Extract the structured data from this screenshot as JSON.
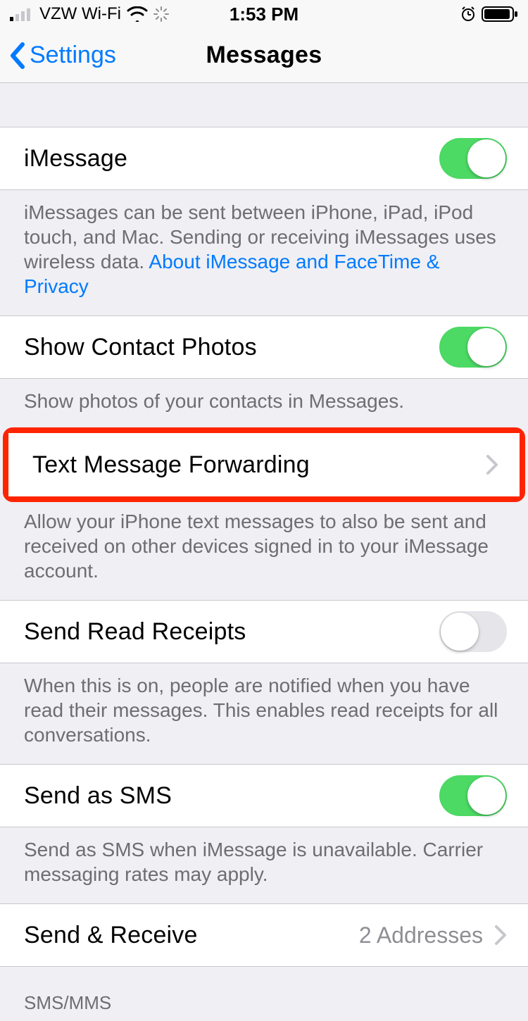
{
  "status": {
    "carrier": "VZW Wi-Fi",
    "time": "1:53 PM"
  },
  "nav": {
    "back": "Settings",
    "title": "Messages"
  },
  "rows": {
    "imessage": {
      "label": "iMessage",
      "on": true
    },
    "imessage_footer": "iMessages can be sent between iPhone, iPad, iPod touch, and Mac. Sending or receiving iMessages uses wireless data. ",
    "imessage_link": "About iMessage and FaceTime & Privacy",
    "contact_photos": {
      "label": "Show Contact Photos",
      "on": true
    },
    "contact_photos_footer": "Show photos of your contacts in Messages.",
    "forwarding": {
      "label": "Text Message Forwarding"
    },
    "forwarding_footer": "Allow your iPhone text messages to also be sent and received on other devices signed in to your iMessage account.",
    "read_receipts": {
      "label": "Send Read Receipts",
      "on": false
    },
    "read_receipts_footer": "When this is on, people are notified when you have read their messages. This enables read receipts for all conversations.",
    "send_sms": {
      "label": "Send as SMS",
      "on": true
    },
    "send_sms_footer": "Send as SMS when iMessage is unavailable. Carrier messaging rates may apply.",
    "send_receive": {
      "label": "Send & Receive",
      "value": "2 Addresses"
    },
    "sms_header": "SMS/MMS"
  }
}
